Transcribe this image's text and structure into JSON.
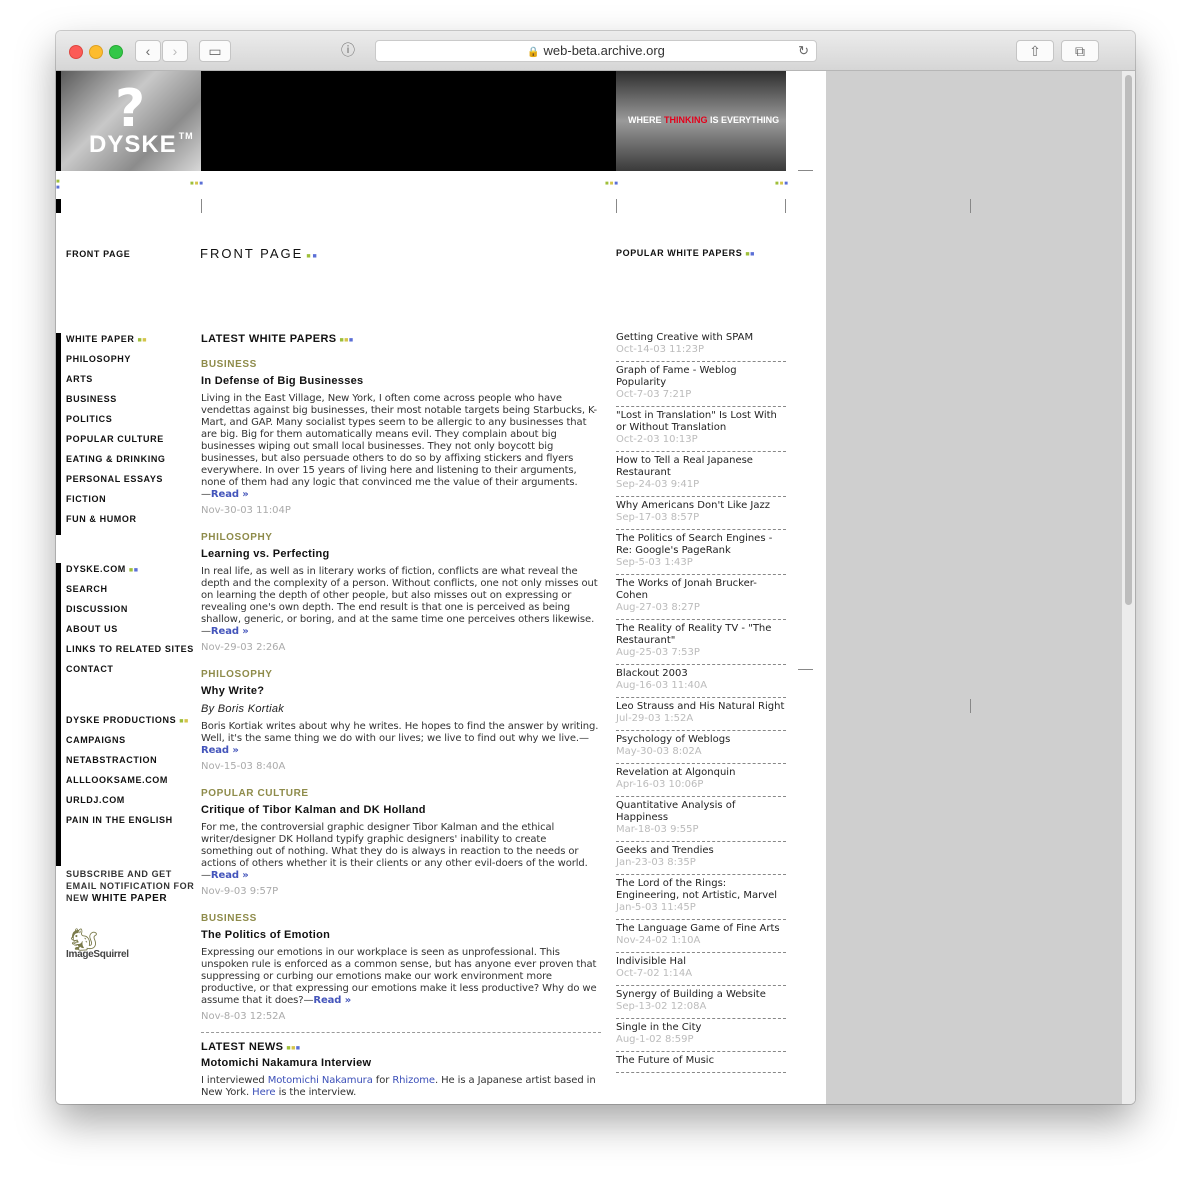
{
  "browser": {
    "url": "web-beta.archive.org",
    "lock_icon": "🔒",
    "back_icon": "‹",
    "forward_icon": "›",
    "sidebar_icon": "▭",
    "reader_icon": "ⓘ",
    "reload_icon": "↻",
    "share_icon": "⇧",
    "tabs_icon": "⧉",
    "new_tab_icon": "+"
  },
  "header": {
    "logo_mark": "?",
    "logo_text": "DYSKE",
    "logo_tm": "TM",
    "tagline_pre": "WHERE ",
    "tagline_hl": "THINKING",
    "tagline_post": " IS EVERYTHING"
  },
  "page_title": "FRONT PAGE",
  "nav": {
    "front_page": "FRONT PAGE",
    "white_paper_group": {
      "title": "WHITE PAPER",
      "items": [
        "PHILOSOPHY",
        "ARTS",
        "BUSINESS",
        "POLITICS",
        "POPULAR CULTURE",
        "EATING & DRINKING",
        "PERSONAL ESSAYS",
        "FICTION",
        "FUN & HUMOR"
      ]
    },
    "dyske_group": {
      "title": "DYSKE.COM",
      "items": [
        "SEARCH",
        "DISCUSSION",
        "ABOUT US",
        "LINKS TO RELATED SITES",
        "CONTACT"
      ]
    },
    "productions_group": {
      "title": "DYSKE PRODUCTIONS",
      "items": [
        "CAMPAIGNS",
        "NETABSTRACTION",
        "ALLLOOKSAME.COM",
        "URLDJ.COM",
        "PAIN IN THE ENGLISH"
      ]
    },
    "subscribe_line1": "SUBSCRIBE AND GET",
    "subscribe_line2": "EMAIL NOTIFICATION FOR",
    "subscribe_line3_pre": "NEW ",
    "subscribe_line3_big": "WHITE PAPER",
    "imagesquirrel": "ImageSquirrel"
  },
  "main": {
    "latest_heading": "LATEST WHITE PAPERS",
    "read_label": "Read »",
    "articles": [
      {
        "category": "BUSINESS",
        "title": "In Defense of Big Businesses",
        "byline": "",
        "body": "Living in the East Village, New York, I often come across people who have vendettas against big businesses, their most notable targets being Starbucks, K-Mart, and GAP. Many socialist types seem to be allergic to any businesses that are big. Big for them automatically means evil. They complain about big businesses wiping out small local businesses. They not only boycott big businesses, but also persuade others to do so by affixing stickers and flyers everywhere. In over 15 years of living here and listening to their arguments, none of them had any logic that convinced me the value of their arguments.",
        "date": "Nov-30-03 11:04P"
      },
      {
        "category": "PHILOSOPHY",
        "title": "Learning vs. Perfecting",
        "byline": "",
        "body": "In real life, as well as in literary works of fiction, conflicts are what reveal the depth and the complexity of a person. Without conflicts, one not only misses out on learning the depth of other people, but also misses out on expressing or revealing one's own depth. The end result is that one is perceived as being shallow, generic, or boring, and at the same time one perceives others likewise.",
        "date": "Nov-29-03 2:26A"
      },
      {
        "category": "PHILOSOPHY",
        "title": "Why Write?",
        "byline": "By Boris Kortiak",
        "body": "Boris Kortiak writes about why he writes. He hopes to find the answer by writing. Well, it's the same thing we do with our lives; we live to find out why we live.",
        "date": "Nov-15-03 8:40A"
      },
      {
        "category": "POPULAR CULTURE",
        "title": "Critique of Tibor Kalman and DK Holland",
        "byline": "",
        "body": "For me, the controversial graphic designer Tibor Kalman and the ethical writer/designer DK Holland typify graphic designers' inability to create something out of nothing. What they do is always in reaction to the needs or actions of others whether it is their clients or any other evil-doers of the world.",
        "date": "Nov-9-03 9:57P"
      },
      {
        "category": "BUSINESS",
        "title": "The Politics of Emotion",
        "byline": "",
        "body": "Expressing our emotions in our workplace is seen as unprofessional. This unspoken rule is enforced as a common sense, but has anyone ever proven that suppressing or curbing our emotions make our work environment more productive, or that expressing our emotions make it less productive? Why do we assume that it does?",
        "date": "Nov-8-03 12:52A"
      }
    ],
    "news_heading": "LATEST NEWS",
    "news": {
      "title": "Motomichi Nakamura Interview",
      "pre": "I interviewed ",
      "link1": "Motomichi Nakamura",
      "mid": " for ",
      "link2": "Rhizome",
      "mid2": ". He is a Japanese artist based in New York. ",
      "link3": "Here",
      "post": " is the interview."
    }
  },
  "popular": {
    "heading": "POPULAR WHITE PAPERS",
    "items": [
      {
        "title": "Getting Creative with SPAM",
        "date": "Oct-14-03 11:23P"
      },
      {
        "title": "Graph of Fame - Weblog Popularity",
        "date": "Oct-7-03 7:21P"
      },
      {
        "title": "\"Lost in Translation\" Is Lost With or Without Translation",
        "date": "Oct-2-03 10:13P"
      },
      {
        "title": "How to Tell a Real Japanese Restaurant",
        "date": "Sep-24-03 9:41P"
      },
      {
        "title": "Why Americans Don't Like Jazz",
        "date": "Sep-17-03 8:57P"
      },
      {
        "title": "The Politics of Search Engines - Re: Google's PageRank",
        "date": "Sep-5-03 1:43P"
      },
      {
        "title": "The Works of Jonah Brucker-Cohen",
        "date": "Aug-27-03 8:27P"
      },
      {
        "title": "The Reality of Reality TV - \"The Restaurant\"",
        "date": "Aug-25-03 7:53P"
      },
      {
        "title": "Blackout 2003",
        "date": "Aug-16-03 11:40A"
      },
      {
        "title": "Leo Strauss and His Natural Right",
        "date": "Jul-29-03 1:52A"
      },
      {
        "title": "Psychology of Weblogs",
        "date": "May-30-03 8:02A"
      },
      {
        "title": "Revelation at Algonquin",
        "date": "Apr-16-03 10:06P"
      },
      {
        "title": "Quantitative Analysis of Happiness",
        "date": "Mar-18-03 9:55P"
      },
      {
        "title": "Geeks and Trendies",
        "date": "Jan-23-03 8:35P"
      },
      {
        "title": "The Lord of the Rings: Engineering, not Artistic, Marvel",
        "date": "Jan-5-03 11:45P"
      },
      {
        "title": "The Language Game of Fine Arts",
        "date": "Nov-24-02 1:10A"
      },
      {
        "title": "Indivisible Hal",
        "date": "Oct-7-02 1:14A"
      },
      {
        "title": "Synergy of Building a Website",
        "date": "Sep-13-02 12:08A"
      },
      {
        "title": "Single in the City",
        "date": "Aug-1-02 8:59P"
      },
      {
        "title": "The Future of Music",
        "date": ""
      }
    ]
  },
  "colors": {
    "category": "#8e8b4a",
    "link": "#4455bb",
    "date": "#aaaaaa",
    "tagline_highlight": "#e3001a"
  }
}
